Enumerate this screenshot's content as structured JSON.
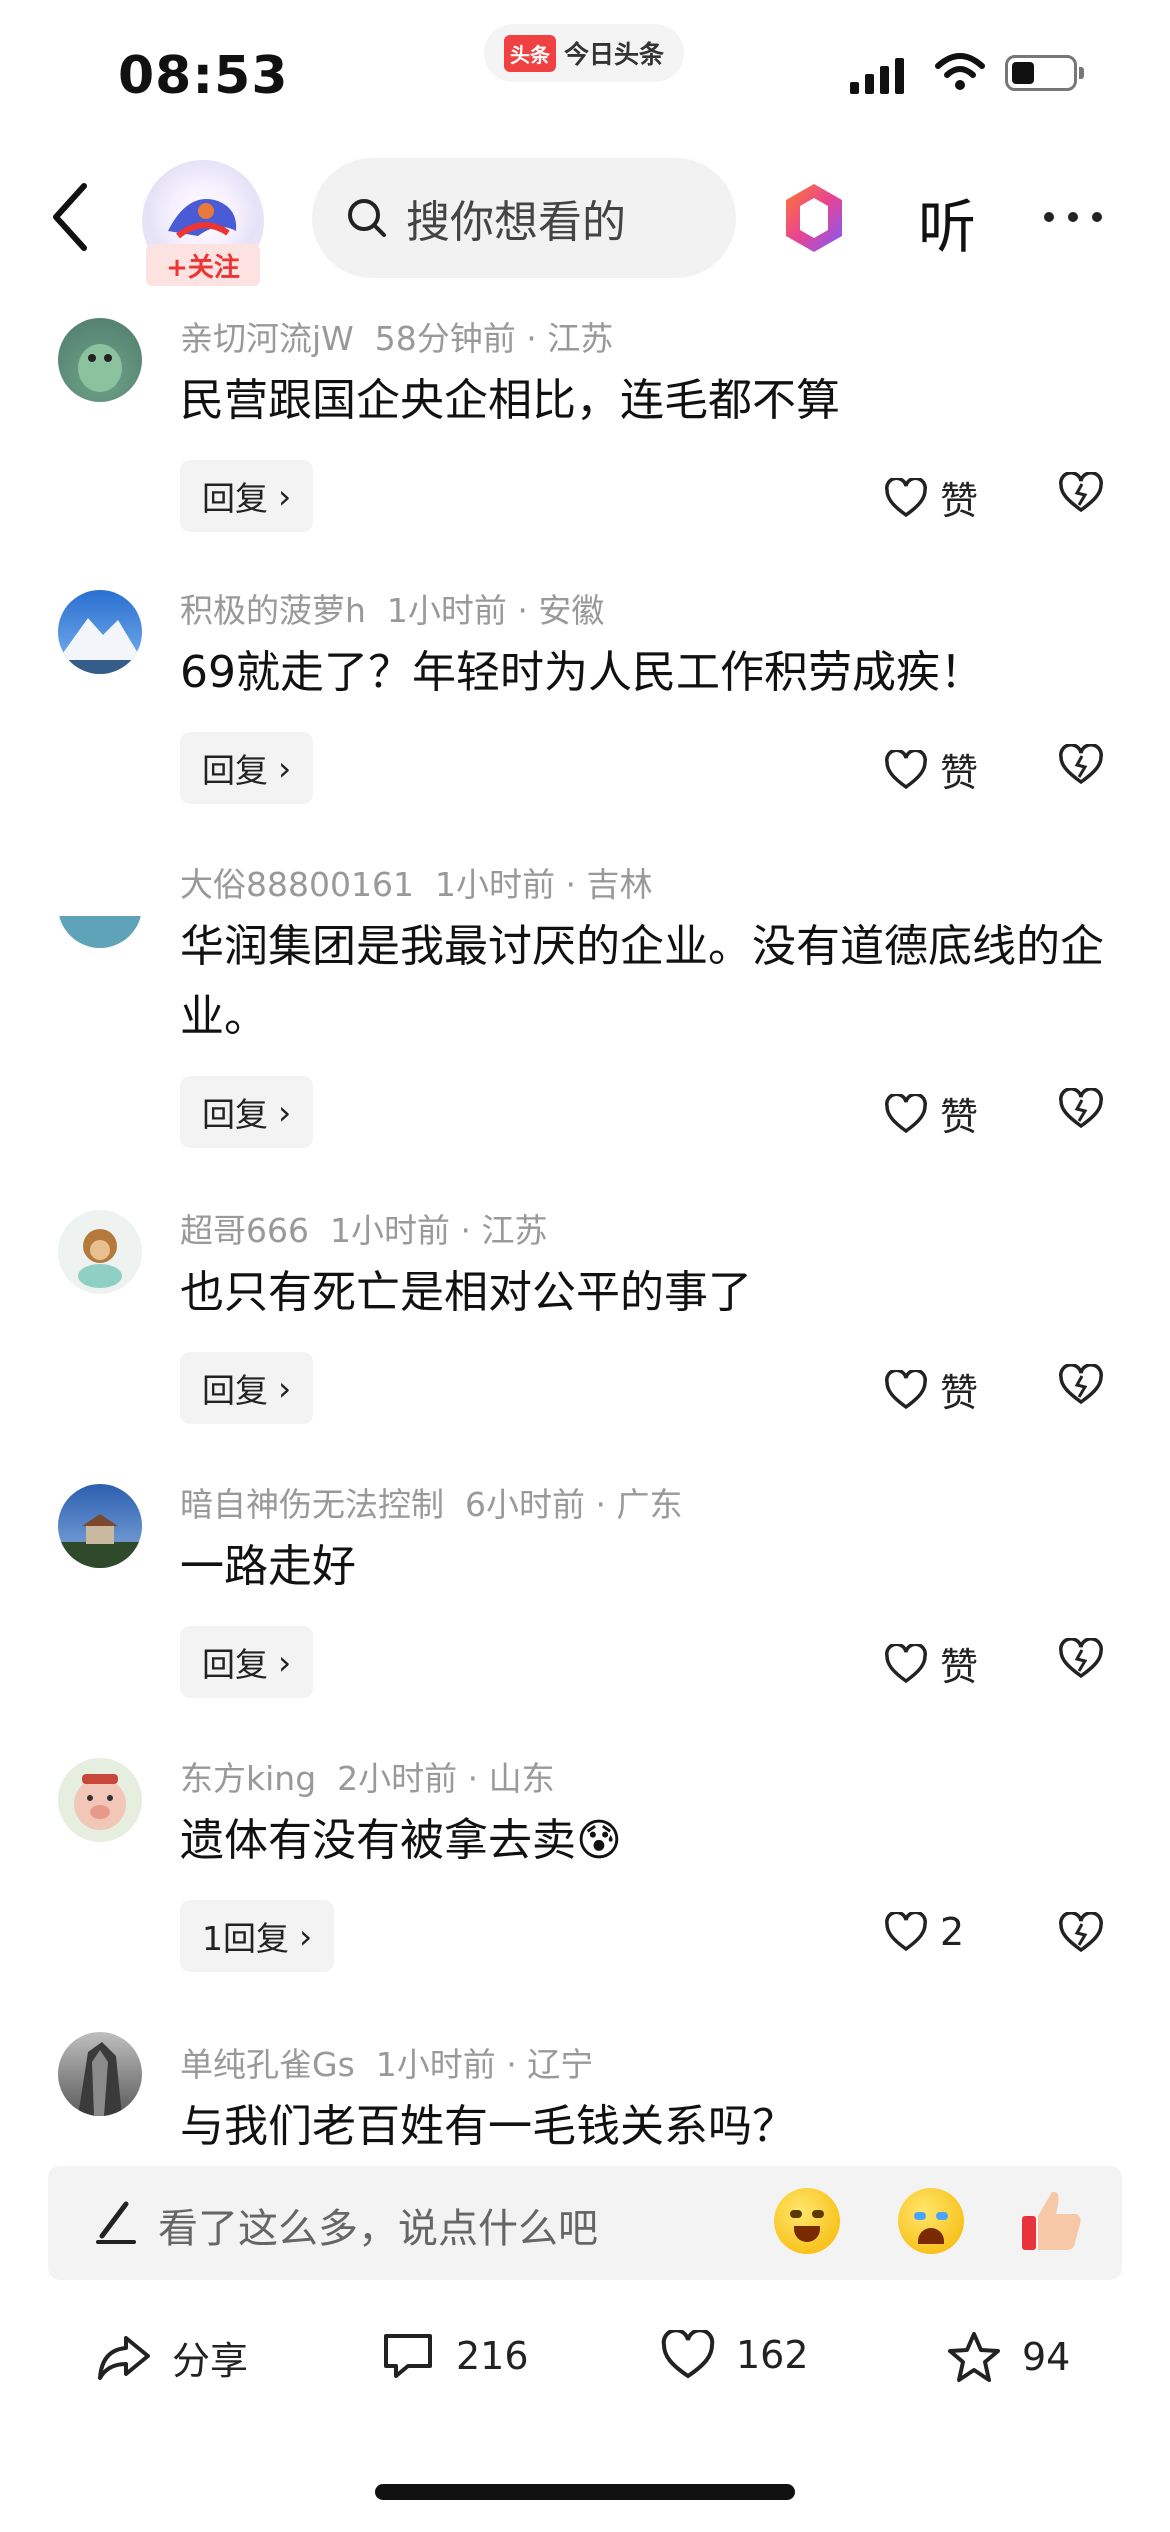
{
  "status_bar": {
    "time": "08:53",
    "app_name": "今日头条",
    "app_logo": "头条"
  },
  "header": {
    "follow_label": "+关注",
    "search_placeholder": "搜你想看的",
    "listen_label": "听"
  },
  "comments": [
    {
      "user": "亲切河流jW",
      "time": "58分钟前",
      "location": "江苏",
      "text": "民营跟国企央企相比，连毛都不算",
      "reply_label": "回复",
      "like_label": "赞"
    },
    {
      "user": "积极的菠萝h",
      "time": "1小时前",
      "location": "安徽",
      "text": "69就走了？年轻时为人民工作积劳成疾！",
      "reply_label": "回复",
      "like_label": "赞"
    },
    {
      "user": "大俗88800161",
      "time": "1小时前",
      "location": "吉林",
      "text": "华润集团是我最讨厌的企业。没有道德底线的企业。",
      "reply_label": "回复",
      "like_label": "赞"
    },
    {
      "user": "超哥666",
      "time": "1小时前",
      "location": "江苏",
      "text": "也只有死亡是相对公平的事了",
      "reply_label": "回复",
      "like_label": "赞"
    },
    {
      "user": "暗自神伤无法控制",
      "time": "6小时前",
      "location": "广东",
      "text": "一路走好",
      "reply_label": "回复",
      "like_label": "赞"
    },
    {
      "user": "东方king",
      "time": "2小时前",
      "location": "山东",
      "text": "遗体有没有被拿去卖😰",
      "reply_label": "1回复",
      "like_label": "2"
    },
    {
      "user": "单纯孔雀Gs",
      "time": "1小时前",
      "location": "辽宁",
      "text": "与我们老百姓有一毛钱关系吗？"
    }
  ],
  "input": {
    "placeholder": "看了这么多，说点什么吧"
  },
  "actions": {
    "share": "分享",
    "comments": "216",
    "likes": "162",
    "favorites": "94"
  },
  "colors": {
    "accent_red": "#f04142",
    "follow_bg": "#fde2e2"
  }
}
